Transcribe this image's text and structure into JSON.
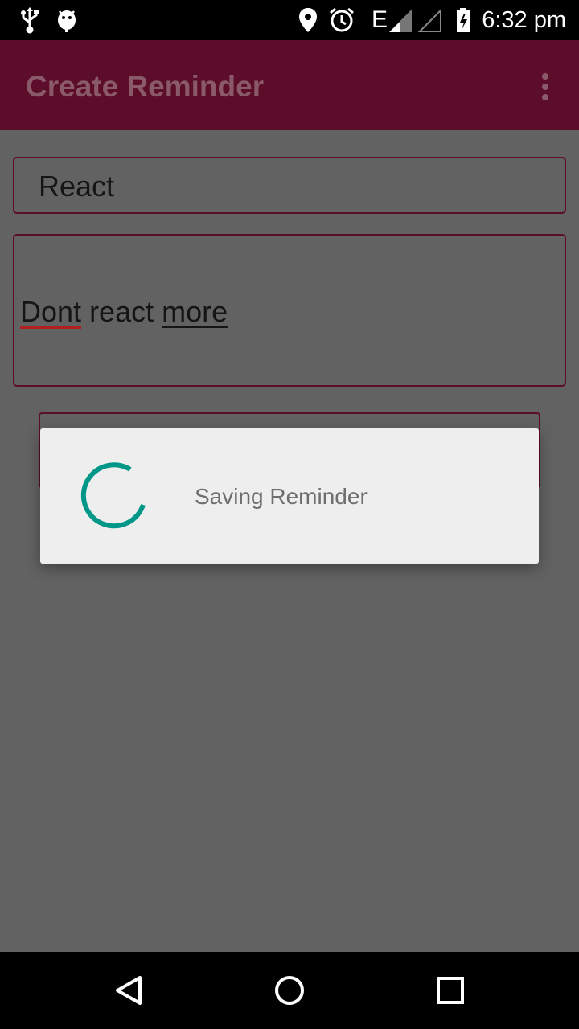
{
  "status_bar": {
    "time": "6:32 pm",
    "network_type": "E",
    "icons": [
      "usb-icon",
      "android-debug-icon",
      "location-icon",
      "alarm-icon",
      "signal-icon",
      "signal-empty-icon",
      "battery-charging-icon"
    ]
  },
  "app_bar": {
    "title": "Create Reminder",
    "overflow_icon": "more-vert-icon"
  },
  "form": {
    "title_value": "React",
    "description_words": [
      "Dont",
      "react",
      "more"
    ]
  },
  "dialog": {
    "message": "Saving Reminder",
    "spinner_color": "#009688"
  },
  "nav_bar": {
    "icons": [
      "back-icon",
      "home-icon",
      "recents-icon"
    ]
  },
  "colors": {
    "primary": "#5c0d29",
    "accent": "#009688",
    "dim_overlay": "#626262"
  }
}
